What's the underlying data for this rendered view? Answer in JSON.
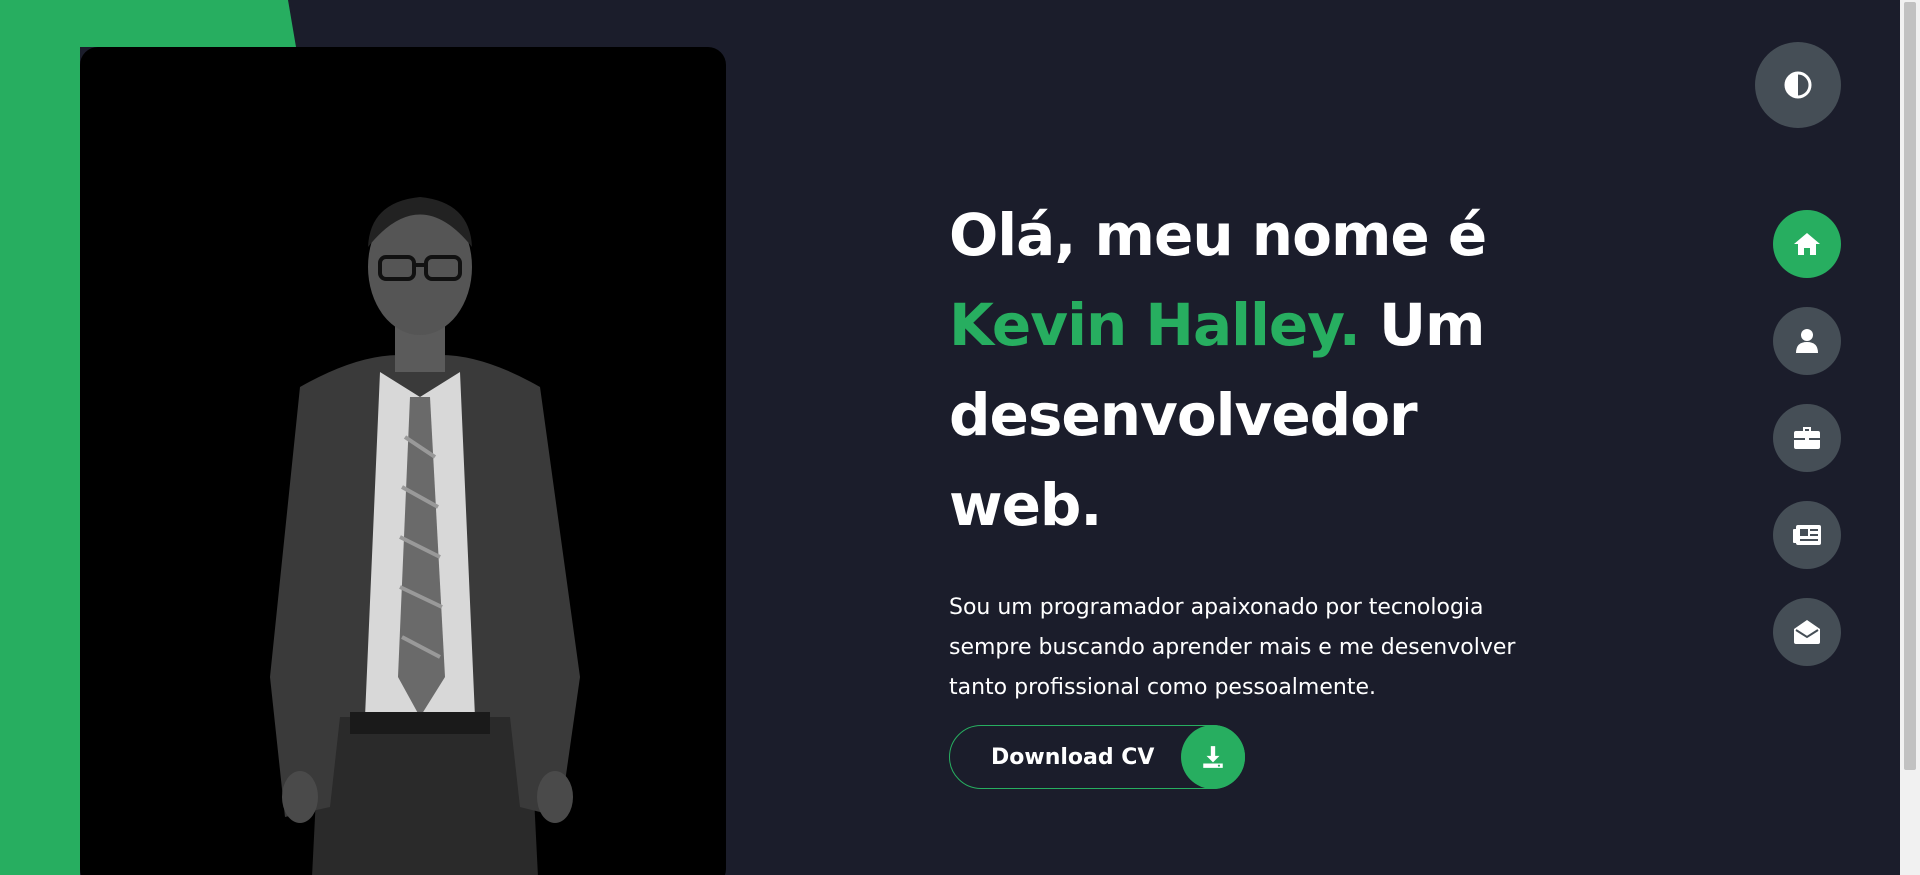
{
  "colors": {
    "background": "#1b1d2b",
    "accent": "#27ae60",
    "button_gray": "#454e56",
    "text": "#ffffff"
  },
  "hero": {
    "headline_part1": "Olá, meu nome é",
    "name": "Kevin Halley.",
    "headline_part2": "Um desenvolvedor web.",
    "intro": "Sou um programador apaixonado por tecnologia sempre buscando aprender mais e me desenvolver tanto profissional como pessoalmente.",
    "download_label": "Download CV",
    "download_icon": "download-icon"
  },
  "controls": {
    "theme_toggle_icon": "contrast-icon"
  },
  "nav": {
    "items": [
      {
        "icon": "home-icon",
        "active": true
      },
      {
        "icon": "user-icon",
        "active": false
      },
      {
        "icon": "briefcase-icon",
        "active": false
      },
      {
        "icon": "newspaper-icon",
        "active": false
      },
      {
        "icon": "envelope-open-icon",
        "active": false
      }
    ]
  }
}
